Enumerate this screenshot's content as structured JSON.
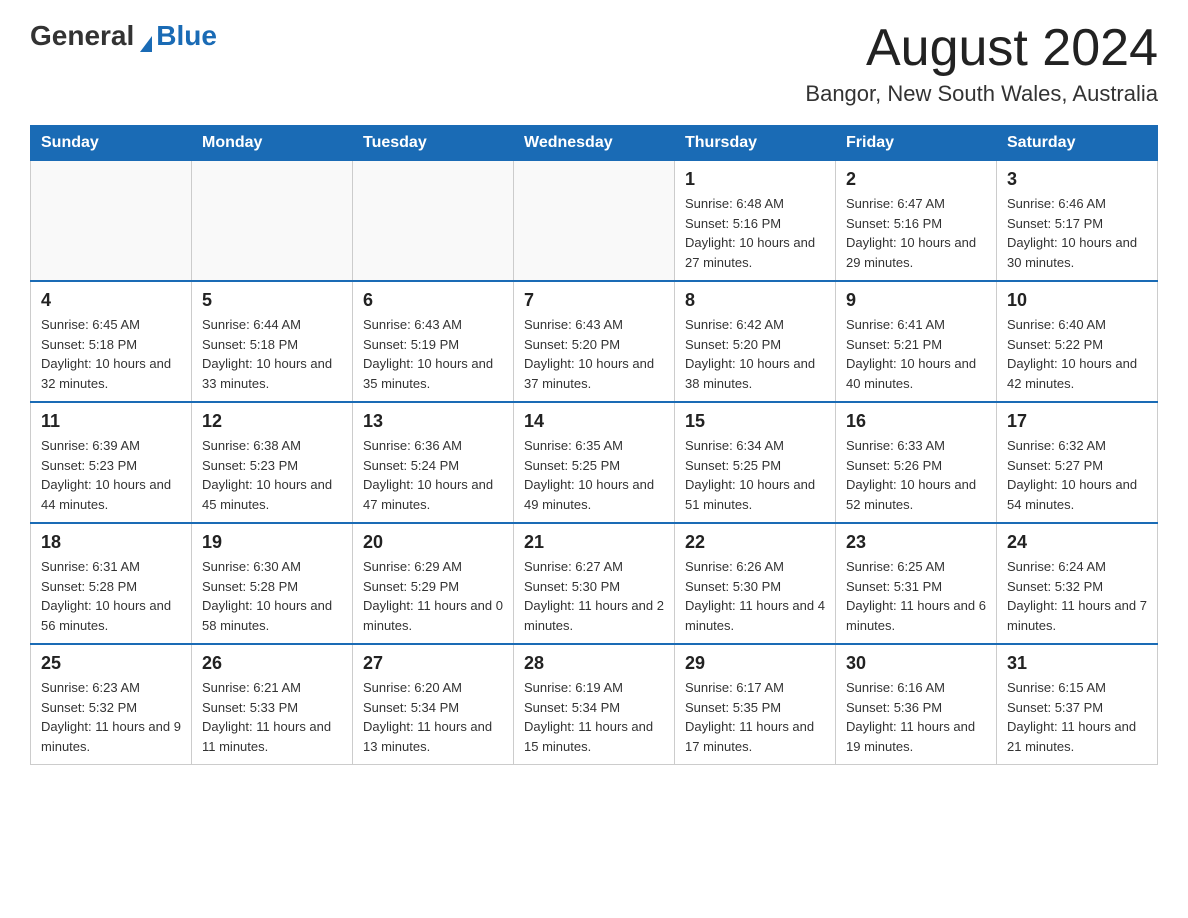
{
  "header": {
    "logo": {
      "text_general": "General",
      "text_blue": "Blue"
    },
    "month_title": "August 2024",
    "location": "Bangor, New South Wales, Australia"
  },
  "weekdays": [
    "Sunday",
    "Monday",
    "Tuesday",
    "Wednesday",
    "Thursday",
    "Friday",
    "Saturday"
  ],
  "weeks": [
    [
      {
        "day": "",
        "info": ""
      },
      {
        "day": "",
        "info": ""
      },
      {
        "day": "",
        "info": ""
      },
      {
        "day": "",
        "info": ""
      },
      {
        "day": "1",
        "info": "Sunrise: 6:48 AM\nSunset: 5:16 PM\nDaylight: 10 hours and 27 minutes."
      },
      {
        "day": "2",
        "info": "Sunrise: 6:47 AM\nSunset: 5:16 PM\nDaylight: 10 hours and 29 minutes."
      },
      {
        "day": "3",
        "info": "Sunrise: 6:46 AM\nSunset: 5:17 PM\nDaylight: 10 hours and 30 minutes."
      }
    ],
    [
      {
        "day": "4",
        "info": "Sunrise: 6:45 AM\nSunset: 5:18 PM\nDaylight: 10 hours and 32 minutes."
      },
      {
        "day": "5",
        "info": "Sunrise: 6:44 AM\nSunset: 5:18 PM\nDaylight: 10 hours and 33 minutes."
      },
      {
        "day": "6",
        "info": "Sunrise: 6:43 AM\nSunset: 5:19 PM\nDaylight: 10 hours and 35 minutes."
      },
      {
        "day": "7",
        "info": "Sunrise: 6:43 AM\nSunset: 5:20 PM\nDaylight: 10 hours and 37 minutes."
      },
      {
        "day": "8",
        "info": "Sunrise: 6:42 AM\nSunset: 5:20 PM\nDaylight: 10 hours and 38 minutes."
      },
      {
        "day": "9",
        "info": "Sunrise: 6:41 AM\nSunset: 5:21 PM\nDaylight: 10 hours and 40 minutes."
      },
      {
        "day": "10",
        "info": "Sunrise: 6:40 AM\nSunset: 5:22 PM\nDaylight: 10 hours and 42 minutes."
      }
    ],
    [
      {
        "day": "11",
        "info": "Sunrise: 6:39 AM\nSunset: 5:23 PM\nDaylight: 10 hours and 44 minutes."
      },
      {
        "day": "12",
        "info": "Sunrise: 6:38 AM\nSunset: 5:23 PM\nDaylight: 10 hours and 45 minutes."
      },
      {
        "day": "13",
        "info": "Sunrise: 6:36 AM\nSunset: 5:24 PM\nDaylight: 10 hours and 47 minutes."
      },
      {
        "day": "14",
        "info": "Sunrise: 6:35 AM\nSunset: 5:25 PM\nDaylight: 10 hours and 49 minutes."
      },
      {
        "day": "15",
        "info": "Sunrise: 6:34 AM\nSunset: 5:25 PM\nDaylight: 10 hours and 51 minutes."
      },
      {
        "day": "16",
        "info": "Sunrise: 6:33 AM\nSunset: 5:26 PM\nDaylight: 10 hours and 52 minutes."
      },
      {
        "day": "17",
        "info": "Sunrise: 6:32 AM\nSunset: 5:27 PM\nDaylight: 10 hours and 54 minutes."
      }
    ],
    [
      {
        "day": "18",
        "info": "Sunrise: 6:31 AM\nSunset: 5:28 PM\nDaylight: 10 hours and 56 minutes."
      },
      {
        "day": "19",
        "info": "Sunrise: 6:30 AM\nSunset: 5:28 PM\nDaylight: 10 hours and 58 minutes."
      },
      {
        "day": "20",
        "info": "Sunrise: 6:29 AM\nSunset: 5:29 PM\nDaylight: 11 hours and 0 minutes."
      },
      {
        "day": "21",
        "info": "Sunrise: 6:27 AM\nSunset: 5:30 PM\nDaylight: 11 hours and 2 minutes."
      },
      {
        "day": "22",
        "info": "Sunrise: 6:26 AM\nSunset: 5:30 PM\nDaylight: 11 hours and 4 minutes."
      },
      {
        "day": "23",
        "info": "Sunrise: 6:25 AM\nSunset: 5:31 PM\nDaylight: 11 hours and 6 minutes."
      },
      {
        "day": "24",
        "info": "Sunrise: 6:24 AM\nSunset: 5:32 PM\nDaylight: 11 hours and 7 minutes."
      }
    ],
    [
      {
        "day": "25",
        "info": "Sunrise: 6:23 AM\nSunset: 5:32 PM\nDaylight: 11 hours and 9 minutes."
      },
      {
        "day": "26",
        "info": "Sunrise: 6:21 AM\nSunset: 5:33 PM\nDaylight: 11 hours and 11 minutes."
      },
      {
        "day": "27",
        "info": "Sunrise: 6:20 AM\nSunset: 5:34 PM\nDaylight: 11 hours and 13 minutes."
      },
      {
        "day": "28",
        "info": "Sunrise: 6:19 AM\nSunset: 5:34 PM\nDaylight: 11 hours and 15 minutes."
      },
      {
        "day": "29",
        "info": "Sunrise: 6:17 AM\nSunset: 5:35 PM\nDaylight: 11 hours and 17 minutes."
      },
      {
        "day": "30",
        "info": "Sunrise: 6:16 AM\nSunset: 5:36 PM\nDaylight: 11 hours and 19 minutes."
      },
      {
        "day": "31",
        "info": "Sunrise: 6:15 AM\nSunset: 5:37 PM\nDaylight: 11 hours and 21 minutes."
      }
    ]
  ]
}
